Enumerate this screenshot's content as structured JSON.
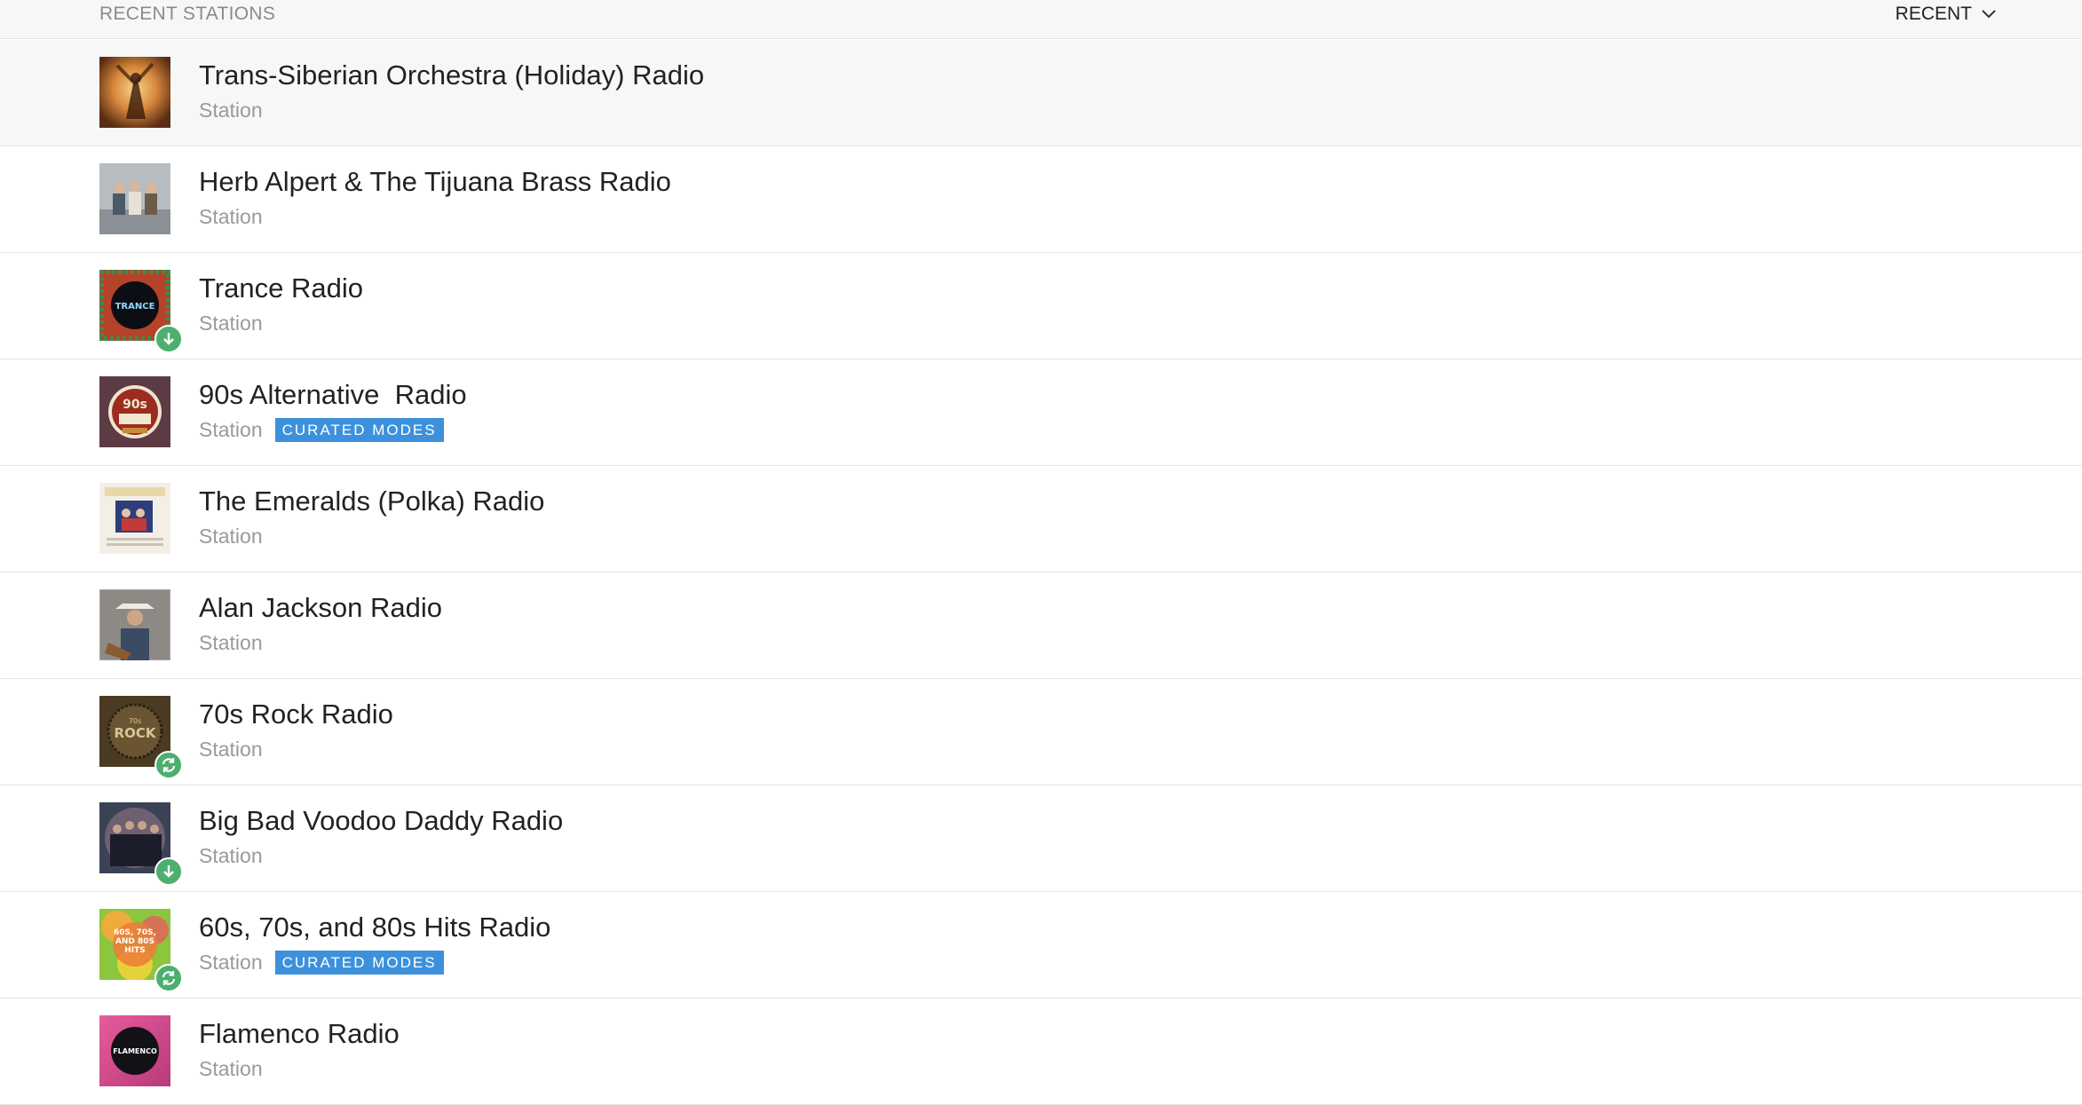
{
  "header": {
    "title": "RECENT STATIONS",
    "sort_label": "RECENT"
  },
  "colors": {
    "header_bg": "#f7f7f7",
    "badge_green": "#4caf6e",
    "tag_blue": "#3d91dc",
    "subtle_text": "#9a9a9a"
  },
  "stations": [
    {
      "name": "Trans-Siberian Orchestra (Holiday) Radio",
      "type": "Station",
      "tag": "",
      "badge": "",
      "selected": true,
      "art": "tso"
    },
    {
      "name": "Herb Alpert & The Tijuana Brass Radio",
      "type": "Station",
      "tag": "",
      "badge": "",
      "selected": false,
      "art": "herb"
    },
    {
      "name": "Trance Radio",
      "type": "Station",
      "tag": "",
      "badge": "download-icon",
      "selected": false,
      "art": "trance",
      "art_text": "TRANCE"
    },
    {
      "name": "90s Alternative  Radio",
      "type": "Station",
      "tag": "CURATED MODES",
      "badge": "",
      "selected": false,
      "art": "alt90",
      "art_text": "90s"
    },
    {
      "name": "The Emeralds (Polka) Radio",
      "type": "Station",
      "tag": "",
      "badge": "",
      "selected": false,
      "art": "polka"
    },
    {
      "name": "Alan Jackson Radio",
      "type": "Station",
      "tag": "",
      "badge": "",
      "selected": false,
      "art": "alan"
    },
    {
      "name": "70s Rock Radio",
      "type": "Station",
      "tag": "",
      "badge": "sync-icon",
      "selected": false,
      "art": "rock70",
      "art_text": "ROCK"
    },
    {
      "name": "Big Bad Voodoo Daddy Radio",
      "type": "Station",
      "tag": "",
      "badge": "download-icon",
      "selected": false,
      "art": "bbvd"
    },
    {
      "name": "60s, 70s, and 80s Hits Radio",
      "type": "Station",
      "tag": "CURATED MODES",
      "badge": "sync-icon",
      "selected": false,
      "art": "hits",
      "art_text": "60S, 70S, AND 80S HITS"
    },
    {
      "name": "Flamenco Radio",
      "type": "Station",
      "tag": "",
      "badge": "",
      "selected": false,
      "art": "flamenco",
      "art_text": "FLAMENCO"
    }
  ]
}
